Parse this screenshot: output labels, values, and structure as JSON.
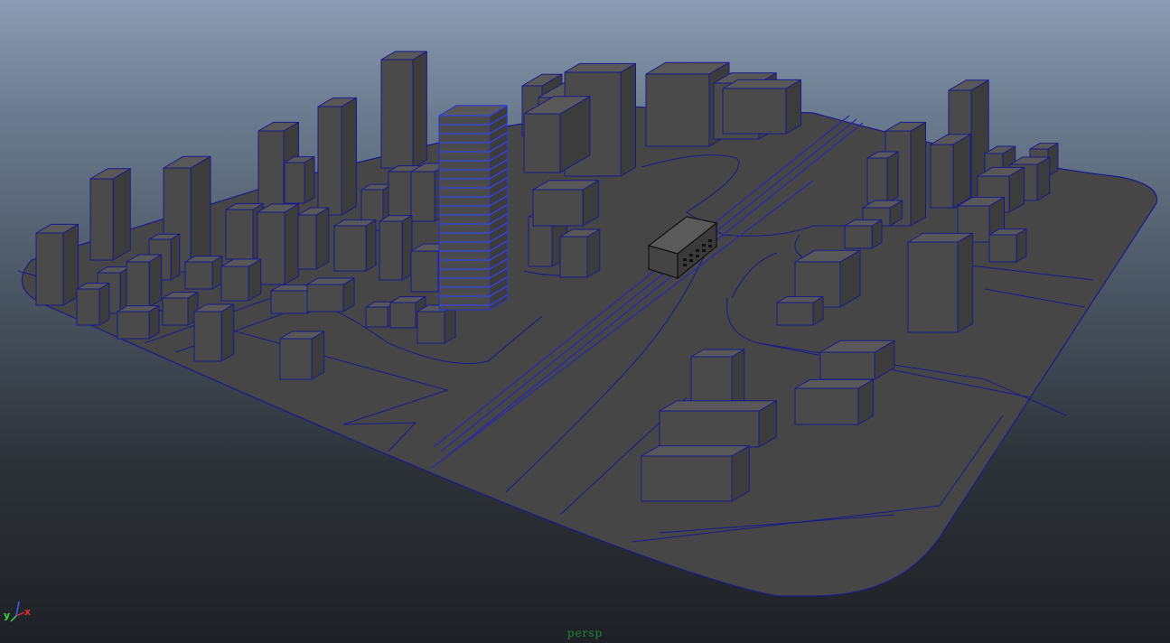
{
  "viewport": {
    "camera_label": "persp"
  },
  "axis_gizmo": {
    "x_label": "x",
    "y_label": "y",
    "x_color": "#e03030",
    "y_color": "#3dd63d",
    "z_color": "#4060ff"
  },
  "colors": {
    "wireframe": "#1a1a8c",
    "selected_wireframe": "#2233dd",
    "surface": "#4a4a4a"
  }
}
